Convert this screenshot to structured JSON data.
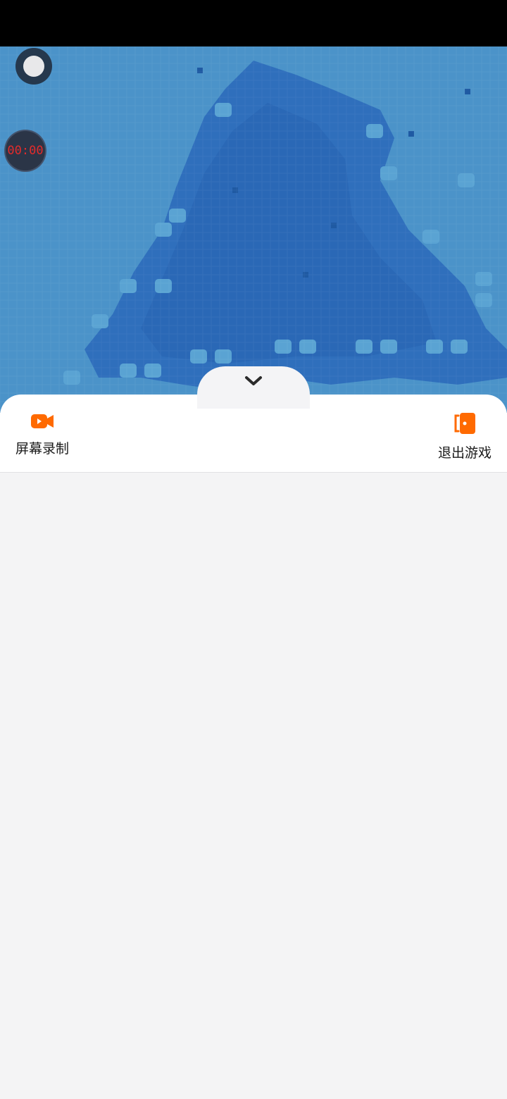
{
  "overlay": {
    "timer_text": "00:00"
  },
  "panel": {
    "actions": [
      {
        "label": "屏幕录制",
        "icon": "video-camera-icon"
      },
      {
        "label": "退出游戏",
        "icon": "exit-door-icon"
      }
    ]
  },
  "colors": {
    "accent": "#ff6a00",
    "game_background": "#3a82c4",
    "panel_background": "#ffffff",
    "page_background": "#f4f4f5",
    "timer_text": "#e32b2b"
  }
}
